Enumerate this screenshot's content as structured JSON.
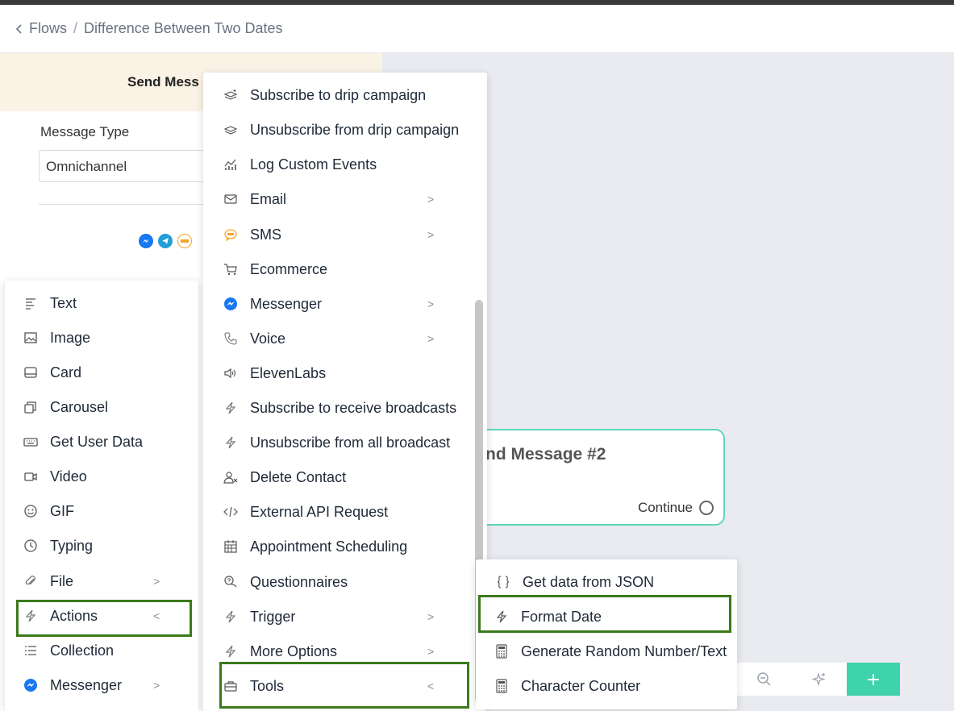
{
  "breadcrumb": {
    "back_label": "Flows",
    "separator": "/",
    "current": "Difference Between Two Dates"
  },
  "panel": {
    "header_title": "Send Mess",
    "message_type_label": "Message Type",
    "message_type_value": "Omnichannel"
  },
  "node": {
    "title": "nd Message #2",
    "continue_label": "Continue"
  },
  "left_menu": {
    "items": [
      {
        "label": "Text",
        "icon": "text-icon"
      },
      {
        "label": "Image",
        "icon": "image-icon"
      },
      {
        "label": "Card",
        "icon": "card-icon"
      },
      {
        "label": "Carousel",
        "icon": "carousel-icon"
      },
      {
        "label": "Get User Data",
        "icon": "keyboard-icon"
      },
      {
        "label": "Video",
        "icon": "video-icon"
      },
      {
        "label": "GIF",
        "icon": "gif-icon"
      },
      {
        "label": "Typing",
        "icon": "clock-icon"
      },
      {
        "label": "File",
        "icon": "paperclip-icon",
        "chevron": ">"
      },
      {
        "label": "Actions",
        "icon": "lightning-icon",
        "chevron": "<"
      },
      {
        "label": "Collection",
        "icon": "list-icon"
      },
      {
        "label": "Messenger",
        "icon": "messenger-icon",
        "chevron": ">"
      }
    ]
  },
  "mid_menu": {
    "items": [
      {
        "label": "Subscribe to drip campaign",
        "icon": "drip-subscribe-icon"
      },
      {
        "label": "Unsubscribe from drip campaign",
        "icon": "drip-unsubscribe-icon"
      },
      {
        "label": "Log Custom Events",
        "icon": "analytics-icon"
      },
      {
        "label": "Email",
        "icon": "email-icon",
        "chevron": ">"
      },
      {
        "label": "SMS",
        "icon": "sms-icon",
        "chevron": ">"
      },
      {
        "label": "Ecommerce",
        "icon": "cart-icon"
      },
      {
        "label": "Messenger",
        "icon": "messenger-icon",
        "chevron": ">"
      },
      {
        "label": "Voice",
        "icon": "phone-icon",
        "chevron": ">"
      },
      {
        "label": "ElevenLabs",
        "icon": "speaker-icon"
      },
      {
        "label": "Subscribe to receive broadcasts",
        "icon": "lightning-icon"
      },
      {
        "label": "Unsubscribe from all broadcast",
        "icon": "lightning-icon"
      },
      {
        "label": "Delete Contact",
        "icon": "user-delete-icon"
      },
      {
        "label": "External API Request",
        "icon": "code-icon"
      },
      {
        "label": "Appointment Scheduling",
        "icon": "calendar-icon"
      },
      {
        "label": "Questionnaires",
        "icon": "chat-question-icon"
      },
      {
        "label": "Trigger",
        "icon": "lightning-icon",
        "chevron": ">"
      },
      {
        "label": "More Options",
        "icon": "lightning-icon",
        "chevron": ">"
      },
      {
        "label": "Tools",
        "icon": "toolbox-icon",
        "chevron": "<"
      }
    ]
  },
  "right_menu": {
    "items": [
      {
        "label": "Get data from JSON",
        "icon": "braces-icon"
      },
      {
        "label": "Format Date",
        "icon": "lightning-icon"
      },
      {
        "label": "Generate Random Number/Text",
        "icon": "calculator-icon"
      },
      {
        "label": "Character Counter",
        "icon": "calculator-icon"
      }
    ]
  },
  "colors": {
    "accent": "#3fd3ad",
    "highlight": "#3b7a1a",
    "messenger": "#1877f2",
    "sms": "#f5a623"
  }
}
